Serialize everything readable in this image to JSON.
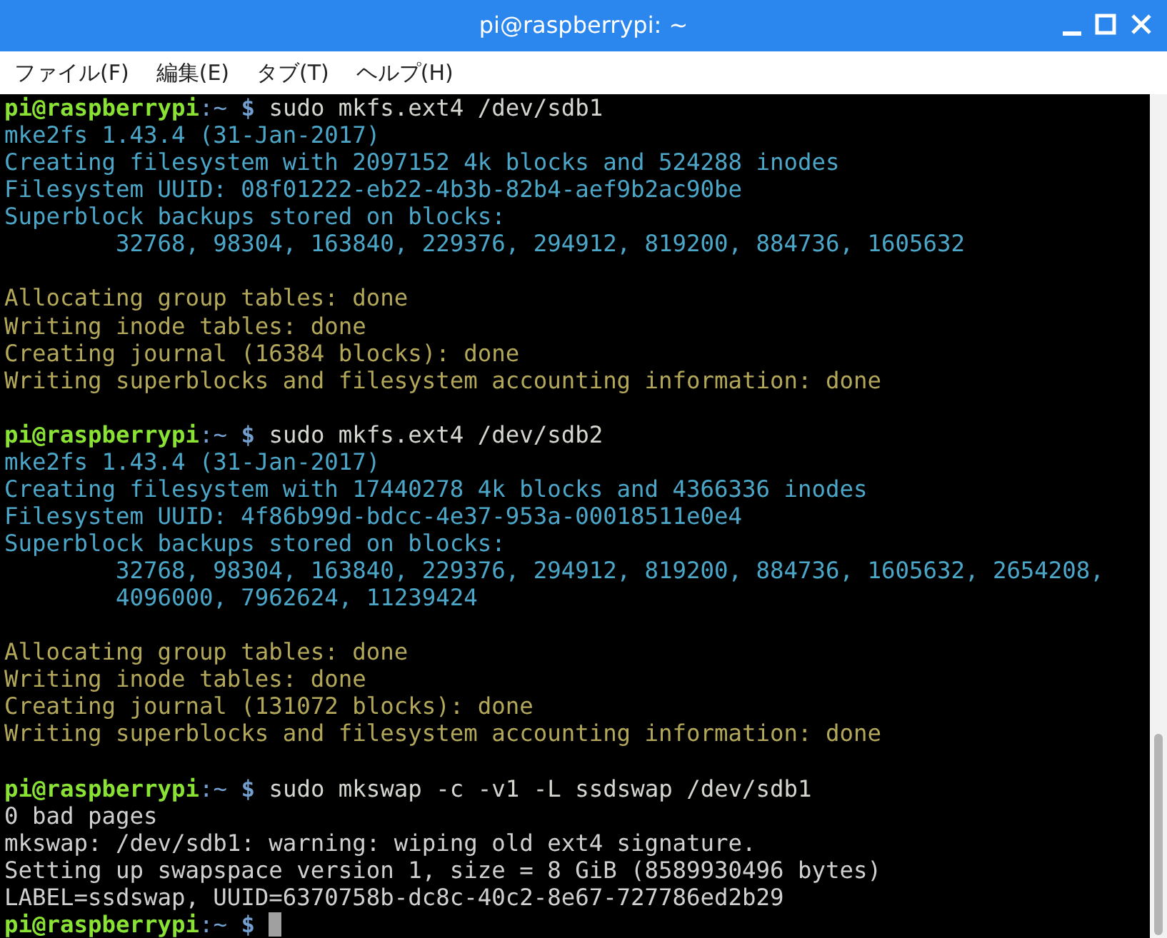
{
  "window": {
    "title": "pi@raspberrypi: ~"
  },
  "menu": [
    "ファイル(F)",
    "編集(E)",
    "タブ(T)",
    "ヘルプ(H)"
  ],
  "terminal": {
    "lines": [
      {
        "kind": "prompt",
        "user": "pi@raspberrypi",
        "path": ":~",
        "symbol": "$",
        "command": "sudo mkfs.ext4 /dev/sdb1"
      },
      {
        "kind": "output",
        "text": "mke2fs 1.43.4 (31-Jan-2017)",
        "color": "#4ba6c8"
      },
      {
        "kind": "output",
        "text": "Creating filesystem with 2097152 4k blocks and 524288 inodes",
        "color": "#4ba6c8"
      },
      {
        "kind": "output",
        "text": "Filesystem UUID: 08f01222-eb22-4b3b-82b4-aef9b2ac90be",
        "color": "#4ba6c8"
      },
      {
        "kind": "output",
        "text": "Superblock backups stored on blocks:",
        "color": "#4ba6c8"
      },
      {
        "kind": "output",
        "text": "        32768, 98304, 163840, 229376, 294912, 819200, 884736, 1605632",
        "color": "#4ba6c8"
      },
      {
        "kind": "blank"
      },
      {
        "kind": "output",
        "text": "Allocating group tables: done",
        "color": "#b3a85a"
      },
      {
        "kind": "output",
        "text": "Writing inode tables: done",
        "color": "#b3a85a"
      },
      {
        "kind": "output",
        "text": "Creating journal (16384 blocks): done",
        "color": "#b3a85a"
      },
      {
        "kind": "output",
        "text": "Writing superblocks and filesystem accounting information: done",
        "color": "#b3a85a"
      },
      {
        "kind": "blank"
      },
      {
        "kind": "prompt",
        "user": "pi@raspberrypi",
        "path": ":~",
        "symbol": "$",
        "command": "sudo mkfs.ext4 /dev/sdb2"
      },
      {
        "kind": "output",
        "text": "mke2fs 1.43.4 (31-Jan-2017)",
        "color": "#4ba6c8"
      },
      {
        "kind": "output",
        "text": "Creating filesystem with 17440278 4k blocks and 4366336 inodes",
        "color": "#4ba6c8"
      },
      {
        "kind": "output",
        "text": "Filesystem UUID: 4f86b99d-bdcc-4e37-953a-00018511e0e4",
        "color": "#4ba6c8"
      },
      {
        "kind": "output",
        "text": "Superblock backups stored on blocks:",
        "color": "#4ba6c8"
      },
      {
        "kind": "output",
        "text": "        32768, 98304, 163840, 229376, 294912, 819200, 884736, 1605632, 2654208,",
        "color": "#4ba6c8"
      },
      {
        "kind": "output",
        "text": "        4096000, 7962624, 11239424",
        "color": "#4ba6c8"
      },
      {
        "kind": "blank"
      },
      {
        "kind": "output",
        "text": "Allocating group tables: done",
        "color": "#b3a85a"
      },
      {
        "kind": "output",
        "text": "Writing inode tables: done",
        "color": "#b3a85a"
      },
      {
        "kind": "output",
        "text": "Creating journal (131072 blocks): done",
        "color": "#b3a85a"
      },
      {
        "kind": "output",
        "text": "Writing superblocks and filesystem accounting information: done",
        "color": "#b3a85a"
      },
      {
        "kind": "blank"
      },
      {
        "kind": "prompt",
        "user": "pi@raspberrypi",
        "path": ":~",
        "symbol": "$",
        "command": "sudo mkswap -c -v1 -L ssdswap /dev/sdb1"
      },
      {
        "kind": "output",
        "text": "0 bad pages",
        "color": "#d0d0d0"
      },
      {
        "kind": "output",
        "text": "mkswap: /dev/sdb1: warning: wiping old ext4 signature.",
        "color": "#d0d0d0"
      },
      {
        "kind": "output",
        "text": "Setting up swapspace version 1, size = 8 GiB (8589930496 bytes)",
        "color": "#d0d0d0"
      },
      {
        "kind": "output",
        "text": "LABEL=ssdswap, UUID=6370758b-dc8c-40c2-8e67-727786ed2b29",
        "color": "#d0d0d0"
      },
      {
        "kind": "prompt",
        "user": "pi@raspberrypi",
        "path": ":~",
        "symbol": "$",
        "cursor": true
      }
    ]
  }
}
